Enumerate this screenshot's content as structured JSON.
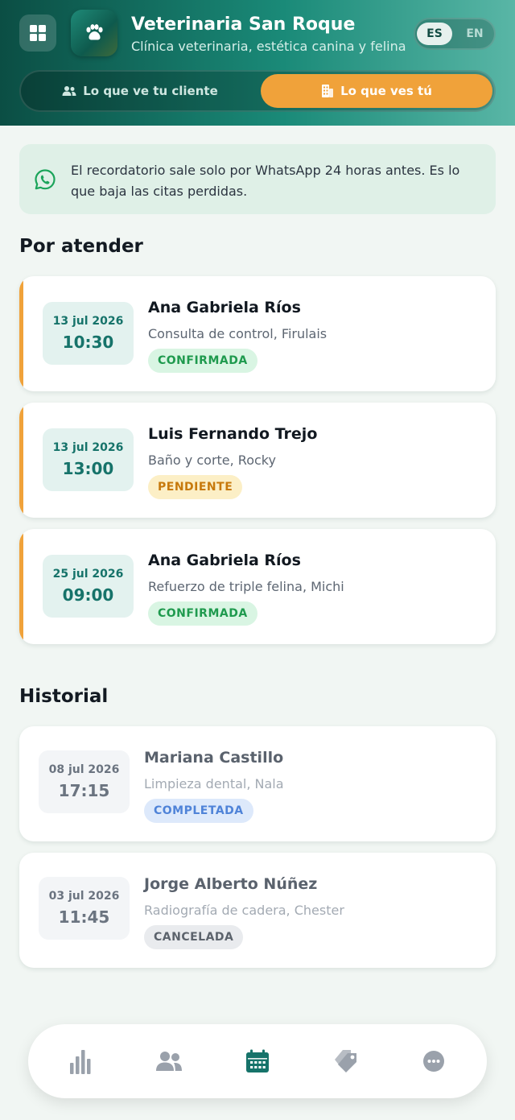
{
  "header": {
    "title": "Veterinaria San Roque",
    "subtitle": "Clínica veterinaria, estética canina y felina",
    "menu_icon": "grid-icon",
    "logo_icon": "paw-icon",
    "languages": [
      {
        "code": "ES",
        "active": true
      },
      {
        "code": "EN",
        "active": false
      }
    ],
    "view_toggle": {
      "client_label": "Lo que ve tu cliente",
      "client_icon": "users-icon",
      "owner_label": "Lo que ves tú",
      "owner_icon": "building-icon",
      "active": "owner"
    }
  },
  "banner": {
    "icon": "whatsapp-icon",
    "text": "El recordatorio sale solo por WhatsApp 24 horas antes. Es lo que baja las citas perdidas."
  },
  "pending_section": {
    "title": "Por atender",
    "appointments": [
      {
        "date": "13 jul 2026",
        "time": "10:30",
        "client": "Ana Gabriela Ríos",
        "service": "Consulta de control, Firulais",
        "status": "CONFIRMADA"
      },
      {
        "date": "13 jul 2026",
        "time": "13:00",
        "client": "Luis Fernando Trejo",
        "service": "Baño y corte, Rocky",
        "status": "PENDIENTE"
      },
      {
        "date": "25 jul 2026",
        "time": "09:00",
        "client": "Ana Gabriela Ríos",
        "service": "Refuerzo de triple felina, Michi",
        "status": "CONFIRMADA"
      }
    ]
  },
  "history_section": {
    "title": "Historial",
    "appointments": [
      {
        "date": "08 jul 2026",
        "time": "17:15",
        "client": "Mariana Castillo",
        "service": "Limpieza dental, Nala",
        "status": "COMPLETADA"
      },
      {
        "date": "03 jul 2026",
        "time": "11:45",
        "client": "Jorge Alberto Núñez",
        "service": "Radiografía de cadera, Chester",
        "status": "CANCELADA"
      }
    ]
  },
  "bottom_nav": {
    "items": [
      {
        "icon": "bar-chart-icon",
        "active": false
      },
      {
        "icon": "users-icon",
        "active": false
      },
      {
        "icon": "calendar-icon",
        "active": true
      },
      {
        "icon": "tag-icon",
        "active": false
      },
      {
        "icon": "more-icon",
        "active": false
      }
    ]
  },
  "colors": {
    "accent": "#16736a",
    "orange": "#f0a23a",
    "icon_inactive": "#9aa1ab"
  }
}
